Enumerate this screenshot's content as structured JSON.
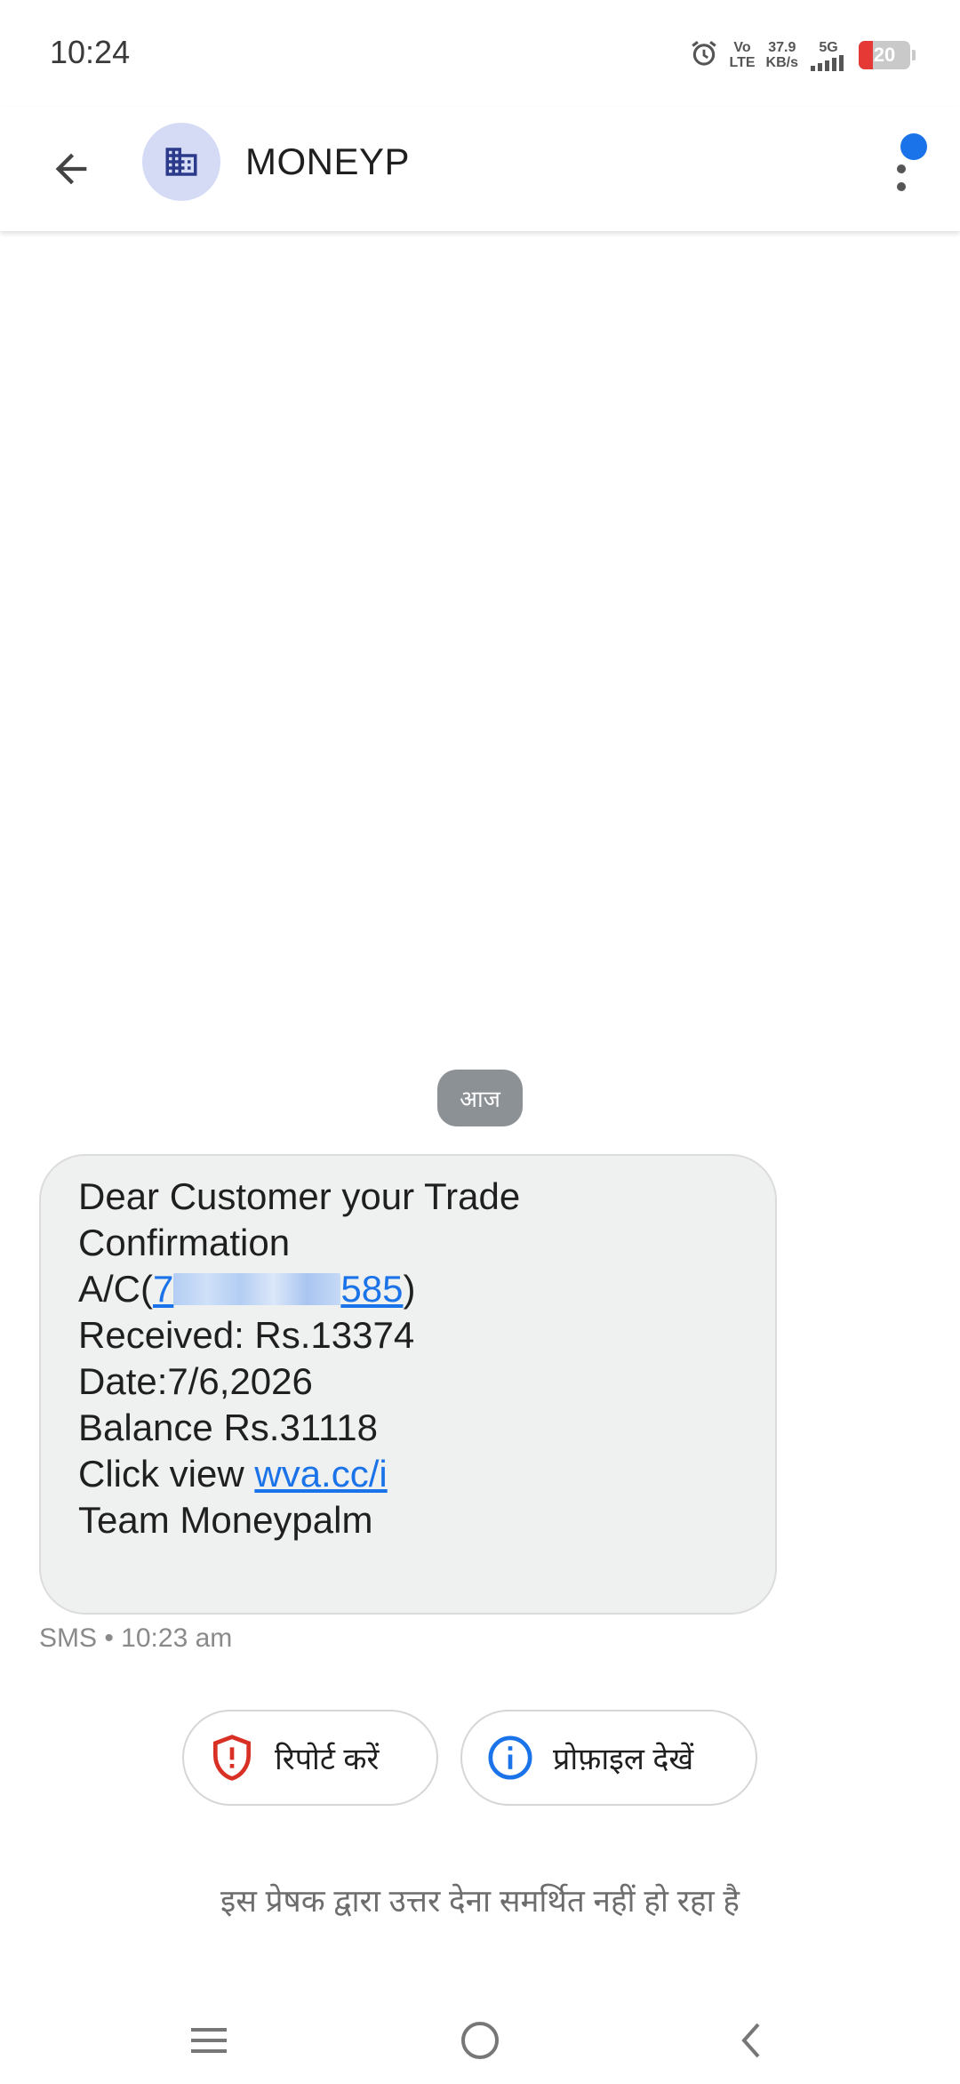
{
  "status_bar": {
    "time": "10:24",
    "network_top": "Vo",
    "network_bottom": "LTE",
    "speed_value": "37.9",
    "speed_unit": "KB/s",
    "signal_label": "5G",
    "battery_level": "20"
  },
  "header": {
    "contact_name": "MONEYP",
    "accent_color": "#1a73e8",
    "avatar_icon": "business-icon"
  },
  "conversation": {
    "date_chip": "आज",
    "message": {
      "line1": "Dear Customer your Trade",
      "line2": "Confirmation",
      "acct_prefix": "A/C(",
      "acct_start": "7",
      "acct_end": "585",
      "acct_suffix": ")",
      "line4": "Received: Rs.13374",
      "line5": "Date:7/6,2026",
      "line6": "Balance Rs.31118",
      "link_prefix": "Click view ",
      "link_text": "wva.cc/i",
      "line8": "Team Moneypalm"
    },
    "meta": "SMS • 10:23 am"
  },
  "actions": {
    "report_label": "रिपोर्ट करें",
    "profile_label": "प्रोफ़ाइल देखें"
  },
  "reply_note": "इस प्रेषक द्वारा उत्तर देना समर्थित नहीं हो रहा है"
}
